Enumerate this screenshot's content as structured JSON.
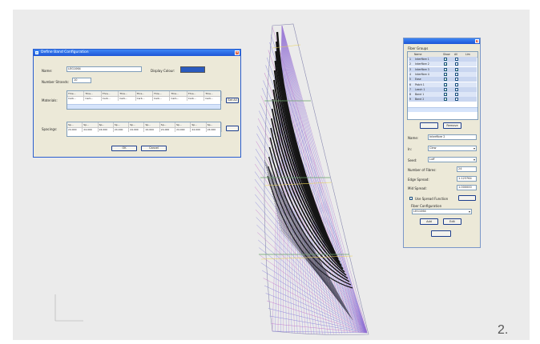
{
  "figure_number": "2.",
  "band_dialog": {
    "title": "Define Band Configuration",
    "name_label": "Name:",
    "name_value": "LEG1064",
    "display_colour_label": "Display Colour:",
    "display_colour_hex": "#2a5bbf",
    "number_strands_label": "Number Strands:",
    "number_strands_value": "10",
    "materials_label": "Materials:",
    "materials_header": [
      "Thre...",
      "Thre...",
      "Thre...",
      "Thre...",
      "Thre...",
      "Thre...",
      "Thre...",
      "Thre...",
      "Thre..."
    ],
    "materials_values": [
      "Carb...",
      "Carb...",
      "Carb...",
      "Carb...",
      "Carb...",
      "Carb...",
      "Carb...",
      "Carb...",
      "Carb..."
    ],
    "set_all_label": "Set All",
    "spacings_label": "Spacings:",
    "spacings_header": [
      "Sp...",
      "Sp...",
      "Sp...",
      "Sp...",
      "Sp...",
      "Sp...",
      "Sp...",
      "Sp...",
      "Sp...",
      "Sp..."
    ],
    "spacings_values": [
      "24.000",
      "24.000",
      "24.000",
      "24.000",
      "24.000",
      "24.000",
      "24.000",
      "24.000",
      "24.000",
      "24.000"
    ],
    "ok_label": "OK",
    "cancel_label": "Cancel"
  },
  "fiber_panel": {
    "fiber_groups_label": "Fiber Groups",
    "columns": [
      "",
      "Name",
      "Show",
      "All",
      "Lim"
    ],
    "rows": [
      {
        "num": "1",
        "name": "Interfibre 1",
        "show": true,
        "all": false
      },
      {
        "num": "2",
        "name": "Interfibre 2",
        "show": true,
        "all": false
      },
      {
        "num": "3",
        "name": "Interfibre 3",
        "show": true,
        "all": true
      },
      {
        "num": "4",
        "name": "Interfibre 4",
        "show": true,
        "all": false
      },
      {
        "num": "5",
        "name": "Ease",
        "show": true,
        "all": false
      },
      {
        "num": "6",
        "name": "Patch 1",
        "show": true,
        "all": false
      },
      {
        "num": "7",
        "name": "Leech 1",
        "show": true,
        "all": false
      },
      {
        "num": "8",
        "name": "Band 1",
        "show": true,
        "all": false
      },
      {
        "num": "9",
        "name": "Band 2",
        "show": true,
        "all": false
      }
    ],
    "remove_label": "Remove",
    "name_label": "Name:",
    "name_value": "Interfibre 2",
    "in_label": "In:",
    "in_value": "Clew",
    "seed_label": "Seed:",
    "seed_value": "Luff",
    "num_fibres_label": "Number of Fibres:",
    "num_fibres_value": "24",
    "edge_spread_label": "Edge Spread:",
    "edge_spread_value": "1.123764",
    "mid_spread_label": "Mid Spread:",
    "mid_spread_value": "1.000000",
    "use_spread_label": "Use Spread Function",
    "fiber_config_label": "Fiber Configuration",
    "fiber_config_value": "LEG1064",
    "add_label": "Add",
    "edit_label": "Edit"
  }
}
